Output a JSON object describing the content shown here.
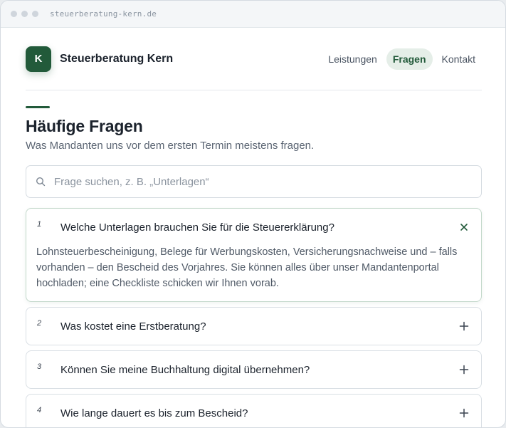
{
  "browser": {
    "url": "steuerberatung-kern.de"
  },
  "header": {
    "logo_letter": "K",
    "brand_name": "Steuerberatung Kern",
    "nav": [
      {
        "label": "Leistungen",
        "active": false
      },
      {
        "label": "Fragen",
        "active": true
      },
      {
        "label": "Kontakt",
        "active": false
      }
    ]
  },
  "main": {
    "title": "Häufige Fragen",
    "subtitle": "Was Mandanten uns vor dem ersten Termin meistens fragen.",
    "search": {
      "placeholder": "Frage suchen, z. B. „Unterlagen“",
      "value": ""
    },
    "faqs": [
      {
        "number": "1",
        "question": "Welche Unterlagen brauchen Sie für die Steuererklärung?",
        "open": true,
        "answer": "Lohnsteuerbescheinigung, Belege für Werbungskosten, Versicherungsnachweise und – falls vorhanden – den Bescheid des Vorjahres. Sie können alles über unser Mandantenportal hochladen; eine Checkliste schicken wir Ihnen vorab."
      },
      {
        "number": "2",
        "question": "Was kostet eine Erstberatung?",
        "open": false
      },
      {
        "number": "3",
        "question": "Können Sie meine Buchhaltung digital übernehmen?",
        "open": false
      },
      {
        "number": "4",
        "question": "Wie lange dauert es bis zum Bescheid?",
        "open": false
      }
    ]
  },
  "colors": {
    "accent": "#225a3a",
    "accent_soft": "#e5eee8"
  }
}
